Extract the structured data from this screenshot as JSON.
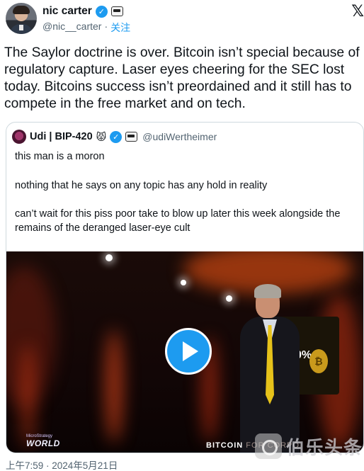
{
  "author": {
    "display_name": "nic carter",
    "handle": "@nic__carter",
    "separator": "·",
    "follow_label": "关注",
    "verified_icon": "verified-check-icon",
    "badge_icon": "affiliate-badge-icon"
  },
  "platform_icon": "x-logo-icon",
  "tweet": {
    "text": "The Saylor doctrine is over. Bitcoin isn’t special because of\nregulatory capture. Laser eyes cheering for the SEC lost\ntoday. Bitcoins success isn’t preordained and it still has to\ncompete in the free market and on tech."
  },
  "quote": {
    "display_name": "Udi | BIP-420",
    "emoji": "😾",
    "handle": "@udiWertheimer",
    "lines": [
      "this man is a moron",
      "nothing that he says on any topic has any hold in reality",
      "can’t wait for this piss poor take to blow up later this week alongside the\nremains of the deranged laser-eye cult"
    ],
    "video": {
      "logo_top": "MicroStrategy",
      "logo_bottom": "WORLD",
      "caption_main": "BITCOIN",
      "caption_faded": " FOR CORPO",
      "slide_percent": "0%",
      "slide_coin": "₿"
    }
  },
  "timestamp": "上午7:59 · 2024年5月21日",
  "watermark": "伯乐头条",
  "colors": {
    "accent": "#1d9bf0",
    "text": "#0f1419",
    "muted": "#536471",
    "border": "#cfd9de"
  }
}
